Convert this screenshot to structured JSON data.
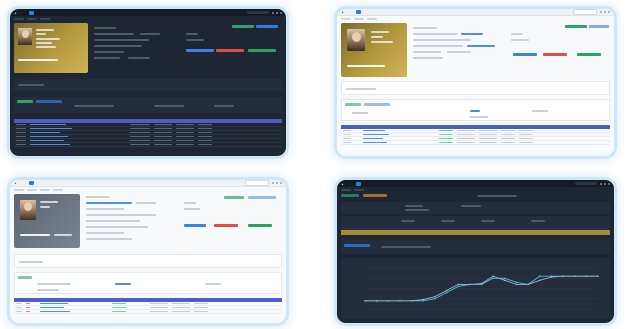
{
  "screens": [
    {
      "id": "tl",
      "theme": "dark"
    },
    {
      "id": "tr",
      "theme": "light"
    },
    {
      "id": "bl",
      "theme": "light"
    },
    {
      "id": "br",
      "theme": "dark"
    }
  ],
  "colors": {
    "accent_blue": "#2f7de1",
    "table_header": "#4b5fc7",
    "stat_blue": "#3b82e6",
    "stat_red": "#e34a4a",
    "stat_green": "#27a461",
    "chart_line_1": "#42c4d6",
    "chart_line_2": "#9fb3c8",
    "gold_band": "#a78a36"
  },
  "icons": {
    "search": "search-icon",
    "notifications": "bell-icon",
    "settings": "gear-icon",
    "user": "avatar"
  },
  "chart_data": {
    "type": "line",
    "title": "",
    "xlabel": "",
    "ylabel": "",
    "x": [
      0,
      1,
      2,
      3,
      4,
      5,
      6,
      7,
      8,
      9,
      10,
      11,
      12,
      13,
      14,
      15,
      16,
      17,
      18,
      19,
      20
    ],
    "series": [
      {
        "values": [
          2,
          2,
          2,
          2,
          2,
          2,
          2.5,
          4,
          5.5,
          6,
          6,
          7.5,
          7.5,
          6.5,
          6,
          8,
          8,
          8,
          8,
          8,
          8
        ]
      },
      {
        "values": [
          2,
          2,
          2,
          2,
          2,
          2.3,
          3,
          4.5,
          6,
          6,
          6.2,
          8,
          7,
          6,
          6,
          7,
          7.8,
          8,
          8,
          8,
          8
        ]
      }
    ],
    "ylim": [
      0,
      10
    ]
  }
}
